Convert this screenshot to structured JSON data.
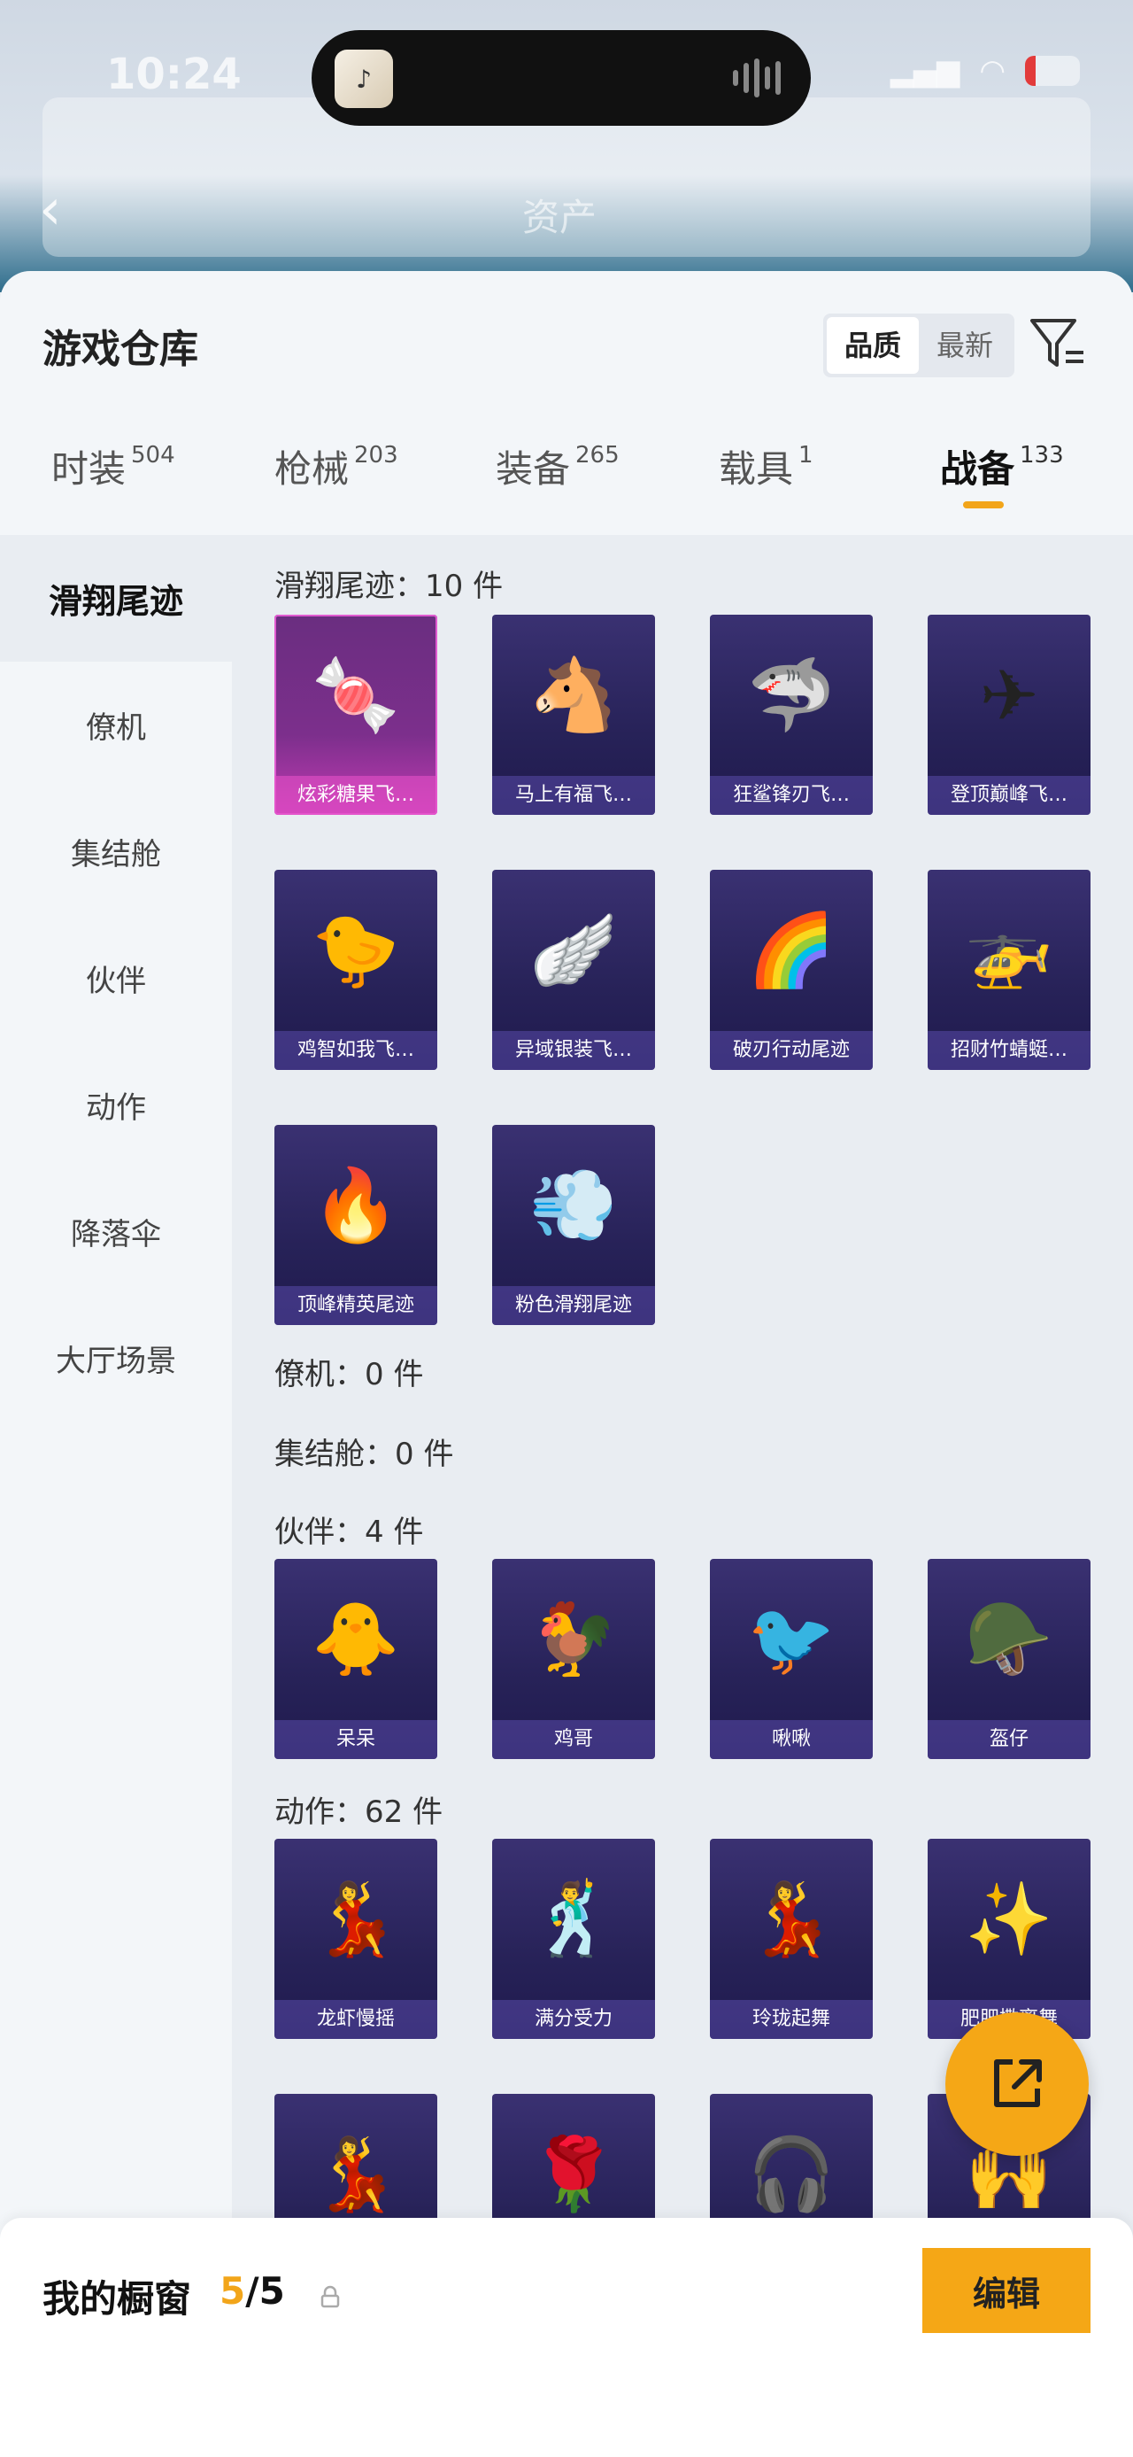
{
  "status_bar": {
    "time": "10:24",
    "battery": "12"
  },
  "background": {
    "title": "资产"
  },
  "sheet": {
    "title": "游戏仓库",
    "sort_options": [
      "品质",
      "最新"
    ],
    "active_sort": "品质"
  },
  "tabs": [
    {
      "label": "时装",
      "count": "504"
    },
    {
      "label": "枪械",
      "count": "203"
    },
    {
      "label": "装备",
      "count": "265"
    },
    {
      "label": "载具",
      "count": "1"
    },
    {
      "label": "战备",
      "count": "133"
    }
  ],
  "sidebar": [
    "滑翔尾迹",
    "僚机",
    "集结舱",
    "伙伴",
    "动作",
    "降落伞",
    "大厅场景"
  ],
  "sections": {
    "glide_trail": {
      "title": "滑翔尾迹：10 件",
      "items": [
        "炫彩糖果飞…",
        "马上有福飞…",
        "狂鲨锋刃飞…",
        "登顶巅峰飞…",
        "鸡智如我飞…",
        "异域银装飞…",
        "破刃行动尾迹",
        "招财竹蜻蜓…",
        "顶峰精英尾迹",
        "粉色滑翔尾迹"
      ]
    },
    "wingman": {
      "title": "僚机：0 件"
    },
    "pod": {
      "title": "集结舱：0 件"
    },
    "partner": {
      "title": "伙伴：4 件",
      "items": [
        "呆呆",
        "鸡哥",
        "啾啾",
        "盔仔"
      ]
    },
    "emote": {
      "title": "动作：62 件",
      "items": [
        "龙虾慢摇",
        "满分受力",
        "玲珑起舞",
        "肥肥撒离舞"
      ]
    }
  },
  "showcase": {
    "title": "我的橱窗",
    "current": "5",
    "total": "/5",
    "edit_label": "编辑"
  },
  "colors": {
    "accent": "#f5a716",
    "card_bg": "#272258",
    "card_highlight": "#c03ab2"
  }
}
